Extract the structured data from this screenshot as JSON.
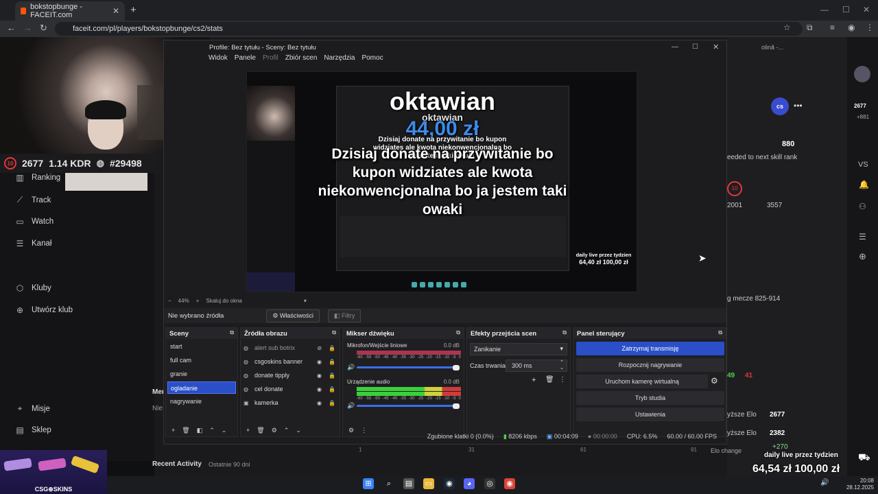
{
  "browser": {
    "tab_title": "bokstopbunge - FACEIT.com",
    "url": "faceit.com/pl/players/bokstopbunge/cs2/stats",
    "partial_right_tab": "olinã -..."
  },
  "elo_bar": {
    "elo": "2677",
    "kdr": "1.14 KDR",
    "rank": "#29498"
  },
  "leftnav": {
    "items": [
      {
        "label": "Ranking",
        "icon": "ranking-icon"
      },
      {
        "label": "Track",
        "icon": "chart-icon"
      },
      {
        "label": "Watch",
        "icon": "watch-icon"
      },
      {
        "label": "Kanał",
        "icon": "channel-icon"
      },
      {
        "label": "Kluby",
        "icon": "clubs-icon"
      },
      {
        "label": "Utwórz klub",
        "icon": "plus-circle-icon"
      },
      {
        "label": "Misje",
        "icon": "missions-icon"
      },
      {
        "label": "Sklep",
        "icon": "shop-icon"
      }
    ],
    "recent_activity": "Recent Activity",
    "recent_sub": "Ostatnie 90 dni",
    "partial_mer": "Mer",
    "partial_nie": "Nie"
  },
  "right_panel": {
    "elo_top": "2677",
    "elo_plus": "+881",
    "skill_value": "880",
    "skill_text": "eeded to next skill rank",
    "elo_low": "2001",
    "elo_high": "3557",
    "matches": "g mecze 825-914",
    "rank_green": "49",
    "rank_red": "41",
    "higher_elo_1": "yższe Elo",
    "higher_elo_val_1": "2677",
    "higher_elo_2": "yższe Elo",
    "higher_elo_val_2": "2382",
    "elo_change": "Elo change",
    "plus270": "+270",
    "chart_ticks": [
      "2200",
      "1",
      "31",
      "61",
      "91"
    ]
  },
  "obs": {
    "title": "Profile: Bez tytułu - Sceny: Bez tytułu",
    "menu": [
      "Widok",
      "Panele",
      "Profil",
      "Zbiór scen",
      "Narzędzia",
      "Pomoc"
    ],
    "overlay": {
      "name": "oktawian",
      "name_small": "oktawian",
      "amount": "44,00 zł",
      "message_small": "Dzisiaj donate na przywitanie bo kupon widziates ale kwota niekonwencjonalna bo ja jestem taki owaki",
      "message": "Dzisiaj donate na przywitanie bo kupon widziates ale kwota niekonwencjonalna bo ja jestem taki owaki",
      "weekly_label": "daily live przez tydzien",
      "weekly_amount": "64,40 zł   100,00 zł"
    },
    "zoom": "44%",
    "zoom_mode": "Skaluj do okna",
    "no_source": "Nie wybrano źródła",
    "properties": "Właściwości",
    "filters": "Filtry",
    "docks": {
      "scenes": {
        "title": "Sceny",
        "items": [
          "start",
          "full cam",
          "granie",
          "ogladanie",
          "nagrywanie"
        ],
        "selected": "ogladanie"
      },
      "sources": {
        "title": "Źródła obrazu",
        "items": [
          "alert sub botrix",
          "csgoskins banner",
          "donate tipply",
          "cel donate",
          "kamerka"
        ]
      },
      "mixer": {
        "title": "Mikser dźwięku",
        "channels": [
          {
            "name": "Mikrofon/Wejście liniowe",
            "db": "0.0 dB"
          },
          {
            "name": "Urządzenie audio",
            "db": "0.0 dB"
          }
        ],
        "scale": [
          "-60",
          "-55",
          "-50",
          "-45",
          "-40",
          "-35",
          "-30",
          "-25",
          "-20",
          "-15",
          "-10",
          "-5",
          "0"
        ]
      },
      "transitions": {
        "title": "Efekty przejścia scen",
        "type": "Zanikanie",
        "duration_label": "Czas trwania",
        "duration": "300 ms"
      },
      "controls": {
        "title": "Panel sterujący",
        "buttons": [
          "Zatrzymaj transmisję",
          "Rozpocznij nagrywanie",
          "Uruchom kamerę wirtualną",
          "Tryb studia",
          "Ustawienia"
        ]
      }
    },
    "status": {
      "dropped": "Zgubione klatki 0 (0.0%)",
      "bitrate": "8206 kbps",
      "live_time": "00:04:09",
      "rec_time": "00:00:00",
      "cpu": "CPU: 6.5%",
      "fps": "60.00 / 60.00 FPS"
    }
  },
  "stream_overlay": {
    "weekly_label": "daily live przez tydzien",
    "weekly_amount": "64,54 zł  100,00 zł",
    "csgo_banner": "CSG⊕SKINS"
  },
  "taskbar": {
    "time": "20:08",
    "date": "28.12.2025"
  },
  "colors": {
    "accent": "#2a4fc9",
    "elo_red": "#e8353a",
    "donate_blue": "#3c8be8"
  }
}
